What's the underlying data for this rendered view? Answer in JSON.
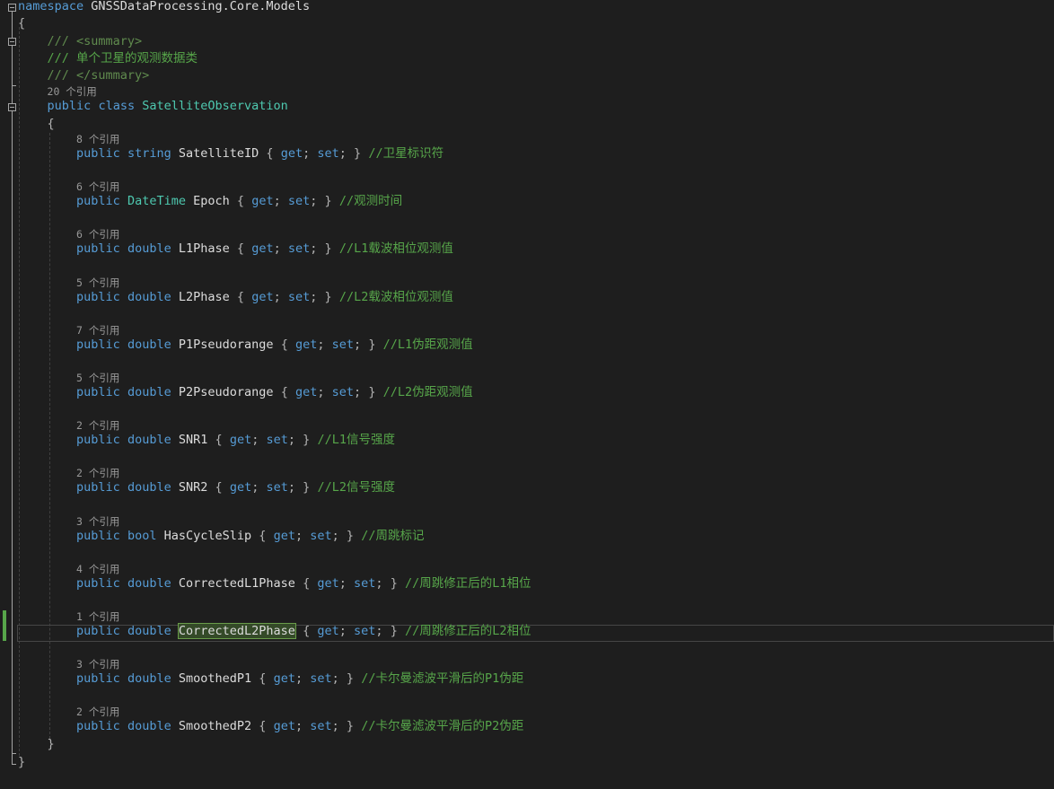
{
  "namespace": {
    "keyword": "namespace",
    "name": "GNSSDataProcessing.Core.Models"
  },
  "summary": {
    "open": "/// <summary>",
    "text": "/// 单个卫星的观测数据类",
    "close": "/// </summary>"
  },
  "class_decl": {
    "refs": "20 个引用",
    "modifier": "public",
    "keyword": "class",
    "name": "SatelliteObservation"
  },
  "braces": {
    "open": "{",
    "close": "}"
  },
  "accessor": {
    "open": "{",
    "get": "get",
    "set": "set",
    "semi": ";",
    "close": "}"
  },
  "properties": [
    {
      "refs": "8 个引用",
      "modifier": "public",
      "type": "string",
      "name": "SatelliteID",
      "comment": "//卫星标识符"
    },
    {
      "refs": "6 个引用",
      "modifier": "public",
      "type": "DateTime",
      "name": "Epoch",
      "comment": "//观测时间"
    },
    {
      "refs": "6 个引用",
      "modifier": "public",
      "type": "double",
      "name": "L1Phase",
      "comment": "//L1载波相位观测值"
    },
    {
      "refs": "5 个引用",
      "modifier": "public",
      "type": "double",
      "name": "L2Phase",
      "comment": "//L2载波相位观测值"
    },
    {
      "refs": "7 个引用",
      "modifier": "public",
      "type": "double",
      "name": "P1Pseudorange",
      "comment": "//L1伪距观测值"
    },
    {
      "refs": "5 个引用",
      "modifier": "public",
      "type": "double",
      "name": "P2Pseudorange",
      "comment": "//L2伪距观测值"
    },
    {
      "refs": "2 个引用",
      "modifier": "public",
      "type": "double",
      "name": "SNR1",
      "comment": "//L1信号强度"
    },
    {
      "refs": "2 个引用",
      "modifier": "public",
      "type": "double",
      "name": "SNR2",
      "comment": "//L2信号强度"
    },
    {
      "refs": "3 个引用",
      "modifier": "public",
      "type": "bool",
      "name": "HasCycleSlip",
      "comment": "//周跳标记"
    },
    {
      "refs": "4 个引用",
      "modifier": "public",
      "type": "double",
      "name": "CorrectedL1Phase",
      "comment": "//周跳修正后的L1相位"
    },
    {
      "refs": "1 个引用",
      "modifier": "public",
      "type": "double",
      "name": "CorrectedL2Phase",
      "comment": "//周跳修正后的L2相位"
    },
    {
      "refs": "3 个引用",
      "modifier": "public",
      "type": "double",
      "name": "SmoothedP1",
      "comment": "//卡尔曼滤波平滑后的P1伪距"
    },
    {
      "refs": "2 个引用",
      "modifier": "public",
      "type": "double",
      "name": "SmoothedP2",
      "comment": "//卡尔曼滤波平滑后的P2伪距"
    }
  ],
  "colors": {
    "background": "#1e1e1e",
    "keyword": "#569cd6",
    "type": "#4ec9b0",
    "comment": "#57a64a",
    "identifier": "#dcdcdc",
    "codelens": "#999999",
    "highlight": "#344a28"
  },
  "icons": [
    "fold-collapse-icon"
  ]
}
